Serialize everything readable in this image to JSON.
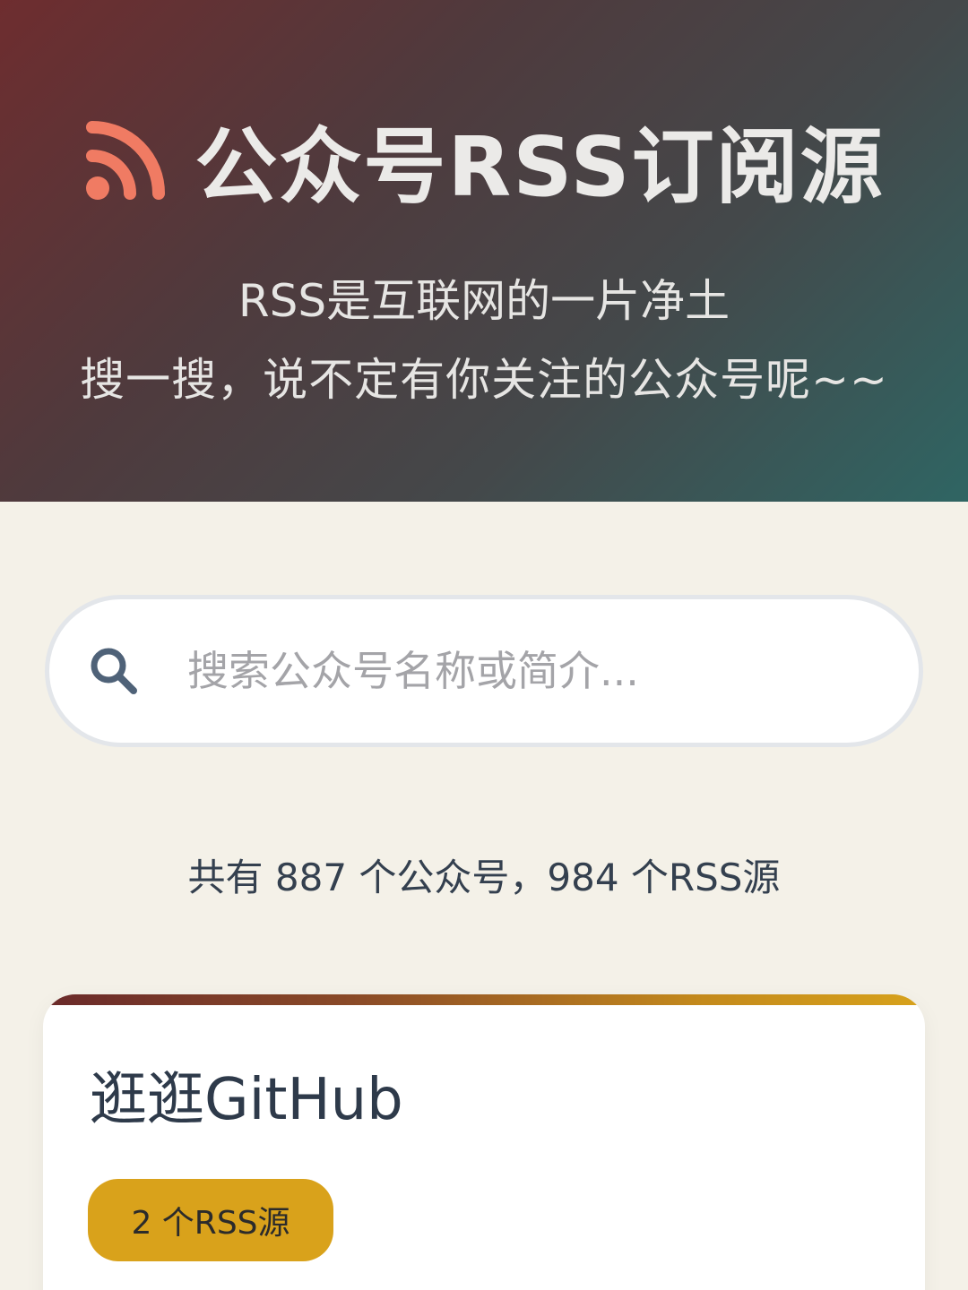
{
  "header": {
    "title": "公众号RSS订阅源",
    "title_icon": "rss-icon",
    "subtitle_line1": "RSS是互联网的一片净土",
    "subtitle_line2": "搜一搜，说不定有你关注的公众号呢~~"
  },
  "search": {
    "icon": "search-icon",
    "placeholder": "搜索公众号名称或简介...",
    "value": ""
  },
  "stats": {
    "text": "共有 887 个公众号，984 个RSS源",
    "account_count": 887,
    "rss_count": 984
  },
  "results": [
    {
      "name": "逛逛GitHub",
      "badge": "2 个RSS源"
    }
  ],
  "colors": {
    "accent_icon": "#f07b63",
    "badge": "#d9a21b",
    "background": "#f4f1e8"
  }
}
